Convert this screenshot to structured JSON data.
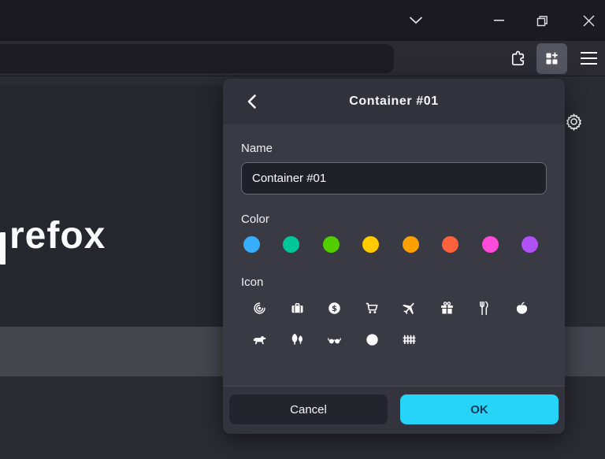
{
  "browser": {
    "page": {
      "wordmark_visible_text": "refox"
    },
    "toolbar_icons": [
      "puzzle-extensions",
      "containers-extension",
      "menu-hamburger"
    ],
    "titlebar_icons": [
      "chevron-down",
      "minimize",
      "restore",
      "close"
    ]
  },
  "popup": {
    "title": "Container #01",
    "name_section": {
      "label": "Name",
      "value": "Container #01"
    },
    "color_section": {
      "label": "Color",
      "colors": [
        {
          "name": "blue",
          "hex": "#37adff"
        },
        {
          "name": "turquoise",
          "hex": "#00c79a"
        },
        {
          "name": "green",
          "hex": "#51cd00"
        },
        {
          "name": "yellow",
          "hex": "#ffcb00"
        },
        {
          "name": "orange",
          "hex": "#ff9f00"
        },
        {
          "name": "red",
          "hex": "#ff613d"
        },
        {
          "name": "pink",
          "hex": "#ff4bda"
        },
        {
          "name": "purple",
          "hex": "#af51f5"
        }
      ]
    },
    "icon_section": {
      "label": "Icon",
      "icons": [
        "fingerprint",
        "briefcase",
        "dollar",
        "cart",
        "vacation",
        "gift",
        "food",
        "fruit",
        "pet",
        "tree",
        "chill",
        "circle",
        "fence"
      ]
    },
    "footer": {
      "cancel_label": "Cancel",
      "ok_label": "OK",
      "ok_color": "#25d4f7",
      "ok_text_color": "#123a5c"
    }
  }
}
